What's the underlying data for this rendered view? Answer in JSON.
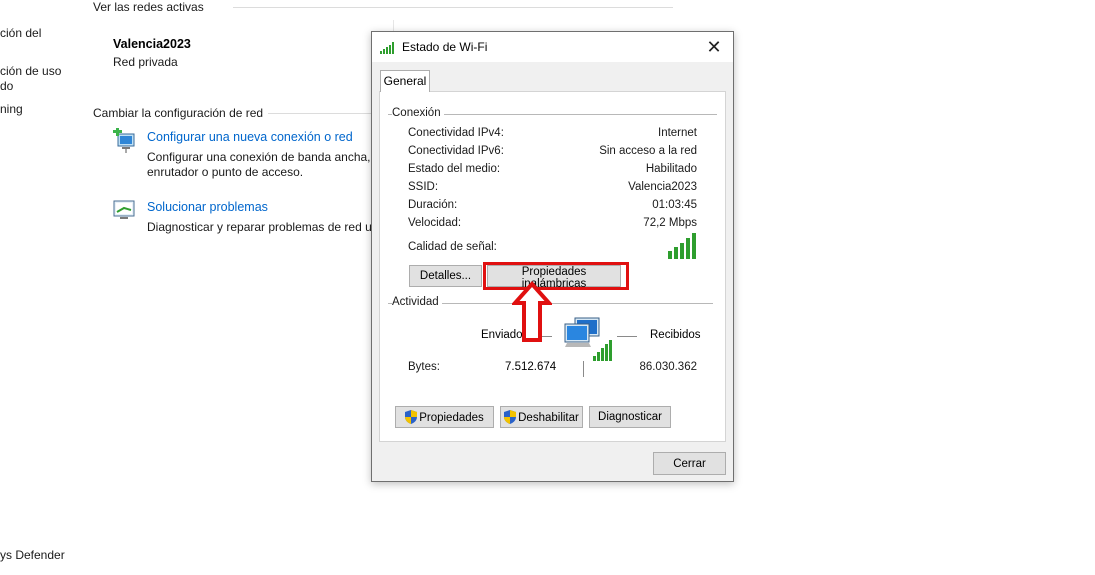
{
  "background": {
    "left_nav": [
      "ción del",
      "ción de uso",
      "do",
      "ning",
      "ys Defender"
    ],
    "active_networks_header": "Ver las redes activas",
    "network_name": "Valencia2023",
    "network_type": "Red privada",
    "change_config_header": "Cambiar la configuración de red",
    "new_connection_link": "Configurar una nueva conexión o red",
    "new_connection_desc_1": "Configurar una conexión de banda ancha,",
    "new_connection_desc_2": "enrutador o punto de acceso.",
    "troubleshoot_link": "Solucionar problemas",
    "troubleshoot_desc": "Diagnosticar y reparar problemas de red u"
  },
  "dialog": {
    "title": "Estado de Wi-Fi",
    "close_glyph": "✕",
    "tab_general": "General",
    "connection_group": "Conexión",
    "rows": [
      {
        "key": "Conectividad IPv4:",
        "value": "Internet"
      },
      {
        "key": "Conectividad IPv6:",
        "value": "Sin acceso a la red"
      },
      {
        "key": "Estado del medio:",
        "value": "Habilitado"
      },
      {
        "key": "SSID:",
        "value": "Valencia2023"
      },
      {
        "key": "Duración:",
        "value": "01:03:45"
      },
      {
        "key": "Velocidad:",
        "value": "72,2 Mbps"
      }
    ],
    "signal_quality_label": "Calidad de señal:",
    "signal_bars": 5,
    "details_button": "Detalles...",
    "wireless_props_button": "Propiedades inalámbricas",
    "activity_group": "Actividad",
    "sent_label": "Enviado",
    "received_label": "Recibidos",
    "bytes_label": "Bytes:",
    "bytes_sent": "7.512.674",
    "bytes_received": "86.030.362",
    "properties_button": "Propiedades",
    "disable_button": "Deshabilitar",
    "diagnose_button": "Diagnosticar",
    "close_button": "Cerrar"
  },
  "colors": {
    "link": "#0066cc",
    "highlight": "#e01010",
    "signal_green": "#2e9e2e",
    "button_bg": "#e1e1e1"
  }
}
